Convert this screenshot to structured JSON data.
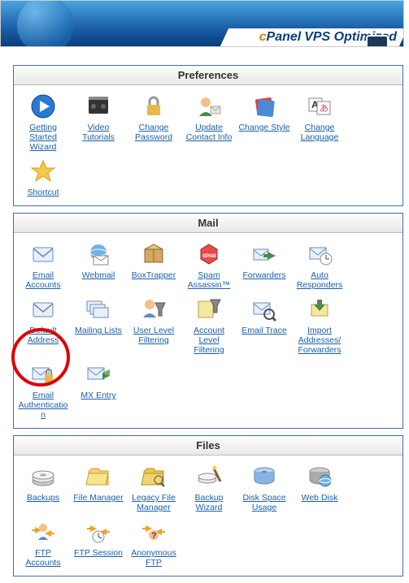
{
  "banner": {
    "logo_prefix": "c",
    "logo_word": "Panel",
    "vps": "VPS Optimized"
  },
  "sections": [
    {
      "title": "Preferences",
      "items": [
        {
          "label": "Getting Started Wizard",
          "icon": "play"
        },
        {
          "label": "Video Tutorials",
          "icon": "video"
        },
        {
          "label": "Change Password",
          "icon": "lock"
        },
        {
          "label": "Update Contact Info",
          "icon": "contact"
        },
        {
          "label": "Change Style",
          "icon": "style"
        },
        {
          "label": "Change Language",
          "icon": "language"
        },
        {
          "label": "Shortcut",
          "icon": "star"
        }
      ]
    },
    {
      "title": "Mail",
      "items": [
        {
          "label": "Email Accounts",
          "icon": "mail"
        },
        {
          "label": "Webmail",
          "icon": "webmail"
        },
        {
          "label": "BoxTrapper",
          "icon": "boxtrapper"
        },
        {
          "label": "Spam Assassin™",
          "icon": "spam"
        },
        {
          "label": "Forwarders",
          "icon": "forward"
        },
        {
          "label": "Auto Responders",
          "icon": "autoresp"
        },
        {
          "label": "Default Address",
          "icon": "mail"
        },
        {
          "label": "Mailing Lists",
          "icon": "maillist"
        },
        {
          "label": "User Level Filtering",
          "icon": "userfilter"
        },
        {
          "label": "Account Level Filtering",
          "icon": "acctfilter"
        },
        {
          "label": "Email Trace",
          "icon": "trace"
        },
        {
          "label": "Import Addresses/ Forwarders",
          "icon": "import"
        },
        {
          "label": "Email Authentication",
          "icon": "auth"
        },
        {
          "label": "MX Entry",
          "icon": "mx"
        }
      ]
    },
    {
      "title": "Files",
      "items": [
        {
          "label": "Backups",
          "icon": "backup"
        },
        {
          "label": "File Manager",
          "icon": "folder"
        },
        {
          "label": "Legacy File Manager",
          "icon": "folderleg"
        },
        {
          "label": "Backup Wizard",
          "icon": "bwizard"
        },
        {
          "label": "Disk Space Usage",
          "icon": "disk"
        },
        {
          "label": "Web Disk",
          "icon": "webdisk"
        },
        {
          "label": "FTP Accounts",
          "icon": "ftpacct"
        },
        {
          "label": "FTP Session",
          "icon": "ftpsess"
        },
        {
          "label": "Anonymous FTP",
          "icon": "ftpanon"
        }
      ]
    }
  ]
}
